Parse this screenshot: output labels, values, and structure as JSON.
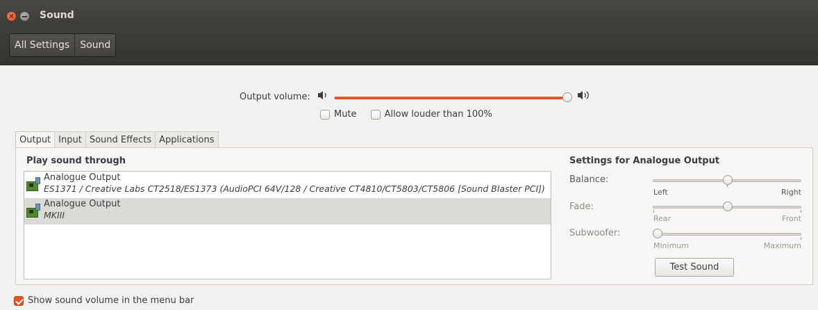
{
  "window": {
    "title": "Sound"
  },
  "breadcrumb": {
    "items": [
      "All Settings",
      "Sound"
    ]
  },
  "volume": {
    "label": "Output volume:",
    "low_icon": "speaker-low-icon",
    "high_icon": "speaker-high-icon",
    "level_percent": 100
  },
  "options": {
    "mute_label": "Mute",
    "mute_checked": false,
    "louder_label": "Allow louder than 100%",
    "louder_checked": false
  },
  "tabs": [
    "Output",
    "Input",
    "Sound Effects",
    "Applications"
  ],
  "active_tab": "Output",
  "output": {
    "play_title": "Play sound through",
    "devices": [
      {
        "name": "Analogue Output",
        "desc": "ES1371 / Creative Labs CT2518/ES1373 (AudioPCI 64V/128 / Creative CT4810/CT5803/CT5806 [Sound Blaster PCI])",
        "selected": false
      },
      {
        "name": "Analogue Output",
        "desc": "MKIII",
        "selected": true
      }
    ],
    "settings_title": "Settings for Analogue Output",
    "balance": {
      "label": "Balance:",
      "left": "Left",
      "right": "Right",
      "value_fraction": 0.5
    },
    "fade": {
      "label": "Fade:",
      "left": "Rear",
      "right": "Front",
      "value_fraction": 0.5
    },
    "subwoofer": {
      "label": "Subwoofer:",
      "left": "Minimum",
      "right": "Maximum",
      "value_fraction": 0.0
    },
    "test_button": "Test Sound"
  },
  "menu_bar_option": {
    "label": "Show sound volume in the menu bar",
    "checked": true
  },
  "colors": {
    "accent": "#e2572a",
    "titlebar": "#3b3a36"
  }
}
